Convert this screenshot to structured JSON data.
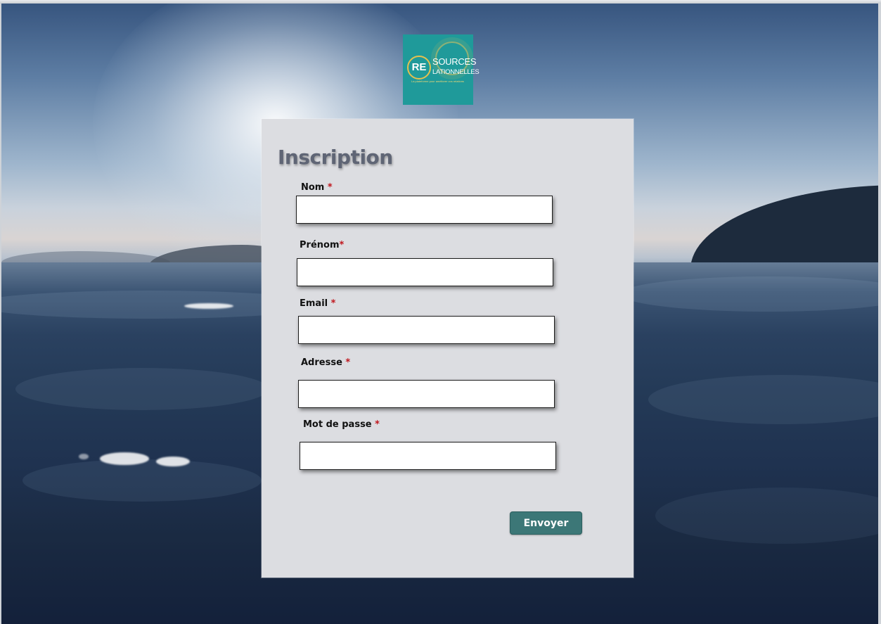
{
  "logo": {
    "mark": "RE",
    "line1": "SOURCES",
    "line2": "LATIONNELLES",
    "tagline": "La plateforme pour améliorer vos relations"
  },
  "form": {
    "title": "Inscription",
    "fields": [
      {
        "label": "Nom",
        "required_mark": "*",
        "value": ""
      },
      {
        "label": "Prénom",
        "required_mark": "*",
        "value": ""
      },
      {
        "label": "Email",
        "required_mark": "*",
        "value": ""
      },
      {
        "label": "Adresse",
        "required_mark": "*",
        "value": ""
      },
      {
        "label": "Mot de passe",
        "required_mark": "*",
        "value": ""
      }
    ],
    "submit_label": "Envoyer"
  },
  "colors": {
    "brand_teal": "#1f9a9a",
    "button": "#3c7777",
    "required": "#c0161d",
    "card": "#dcdde1",
    "title": "#5f6575"
  }
}
